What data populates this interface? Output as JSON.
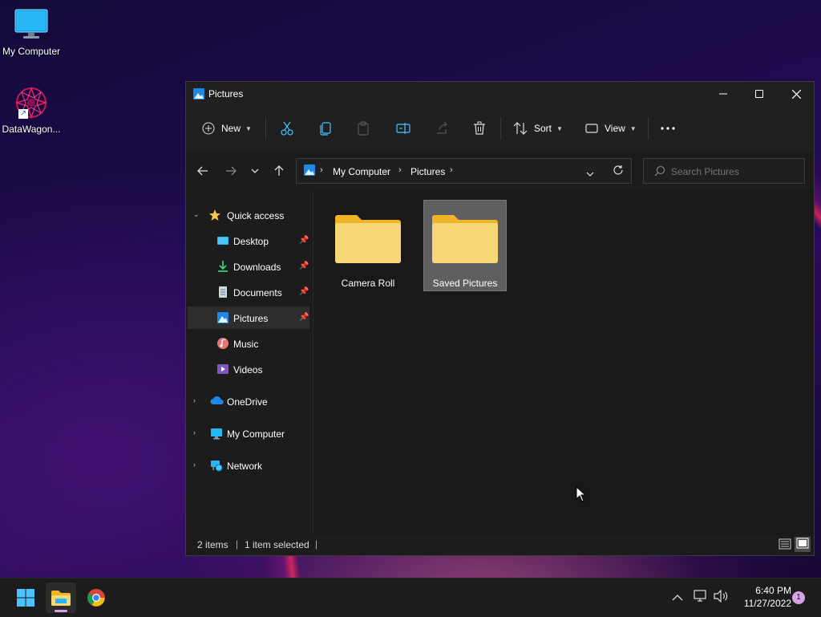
{
  "desktop": {
    "icons": [
      {
        "label": "My Computer"
      },
      {
        "label": "DataWagon..."
      }
    ]
  },
  "window": {
    "title": "Pictures",
    "toolbar": {
      "new_label": "New",
      "sort_label": "Sort",
      "view_label": "View"
    },
    "address": {
      "crumbs": [
        "My Computer",
        "Pictures"
      ]
    },
    "search": {
      "placeholder": "Search Pictures"
    },
    "sidebar": {
      "quick_access": "Quick access",
      "items": [
        {
          "label": "Desktop"
        },
        {
          "label": "Downloads"
        },
        {
          "label": "Documents"
        },
        {
          "label": "Pictures"
        },
        {
          "label": "Music"
        },
        {
          "label": "Videos"
        }
      ],
      "onedrive": "OneDrive",
      "my_computer": "My Computer",
      "network": "Network"
    },
    "folders": [
      {
        "name": "Camera Roll",
        "selected": false
      },
      {
        "name": "Saved Pictures",
        "selected": true
      }
    ],
    "status": {
      "items": "2 items",
      "selected": "1 item selected"
    }
  },
  "taskbar": {
    "clock_time": "6:40 PM",
    "clock_date": "11/27/2022",
    "notification_count": "1"
  },
  "colors": {
    "accent": "#4cc2ff",
    "folder": "#f8c94a",
    "selection": "#5f5f5f",
    "badge": "#d6a2e8"
  }
}
